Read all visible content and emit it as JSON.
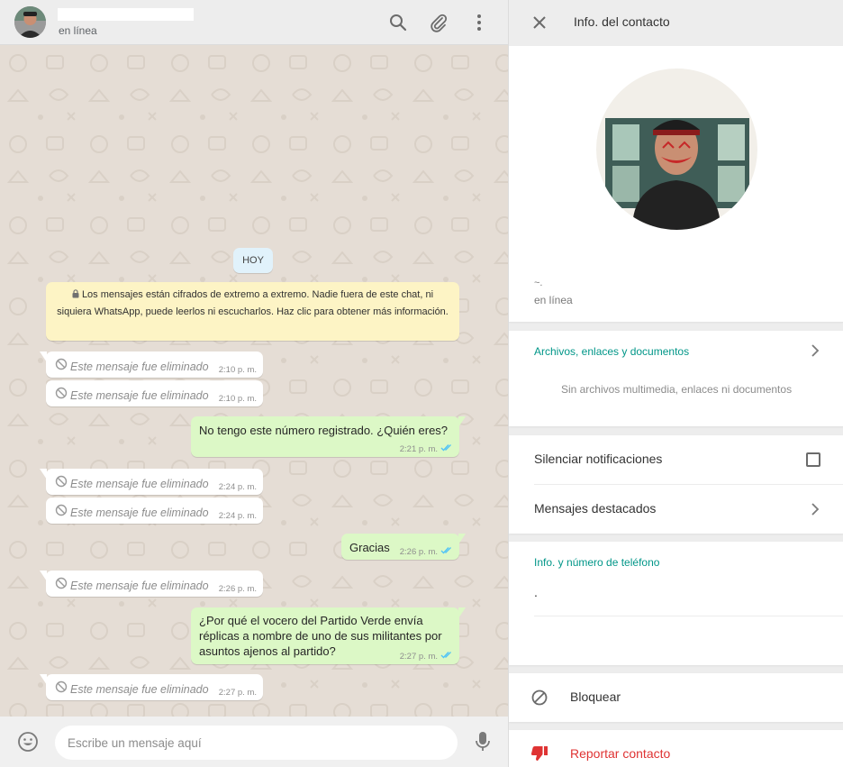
{
  "chat": {
    "header": {
      "status": "en línea",
      "icons": [
        "search-icon",
        "attach-icon",
        "menu-icon"
      ]
    },
    "date_chip": "HOY",
    "encryption_notice": "Los mensajes están cifrados de extremo a extremo. Nadie fuera de este chat, ni siquiera WhatsApp, puede leerlos ni escucharlos. Haz clic para obtener más información.",
    "messages": [
      {
        "direction": "in",
        "deleted": true,
        "text": "Este mensaje fue eliminado",
        "time": "2:10 p. m."
      },
      {
        "direction": "in",
        "deleted": true,
        "text": "Este mensaje fue eliminado",
        "time": "2:10 p. m."
      },
      {
        "direction": "out",
        "deleted": false,
        "text": "No tengo este número registrado. ¿Quién eres?",
        "time": "2:21 p. m."
      },
      {
        "direction": "in",
        "deleted": true,
        "text": "Este mensaje fue eliminado",
        "time": "2:24 p. m."
      },
      {
        "direction": "in",
        "deleted": true,
        "text": "Este mensaje fue eliminado",
        "time": "2:24 p. m."
      },
      {
        "direction": "out",
        "deleted": false,
        "text": "Gracias",
        "time": "2:26 p. m."
      },
      {
        "direction": "in",
        "deleted": true,
        "text": "Este mensaje fue eliminado",
        "time": "2:26 p. m."
      },
      {
        "direction": "out",
        "deleted": false,
        "text": "¿Por qué el vocero del Partido Verde envía réplicas a nombre de uno de sus militantes por asuntos ajenos al partido?",
        "time": "2:27 p. m."
      },
      {
        "direction": "in",
        "deleted": true,
        "text": "Este mensaje fue eliminado",
        "time": "2:27 p. m."
      }
    ],
    "composer": {
      "placeholder": "Escribe un mensaje aquí",
      "icons": [
        "emoji-icon",
        "microphone-icon"
      ]
    }
  },
  "info": {
    "title": "Info. del contacto",
    "about": "~.",
    "status": "en línea",
    "media": {
      "label": "Archivos, enlaces y documentos",
      "empty": "Sin archivos multimedia, enlaces ni documentos"
    },
    "mute_label": "Silenciar notificaciones",
    "mute_checked": false,
    "starred_label": "Mensajes destacados",
    "phone_section": {
      "label": "Info. y número de teléfono",
      "value": "."
    },
    "block_label": "Bloquear",
    "report_label": "Reportar contacto"
  },
  "colors": {
    "accent_teal": "#009688",
    "outgoing_bubble": "#dcf8c6",
    "incoming_bubble": "#ffffff",
    "danger": "#df3333",
    "read_ticks": "#4fc3f7",
    "chat_background": "#e5ddd5"
  }
}
